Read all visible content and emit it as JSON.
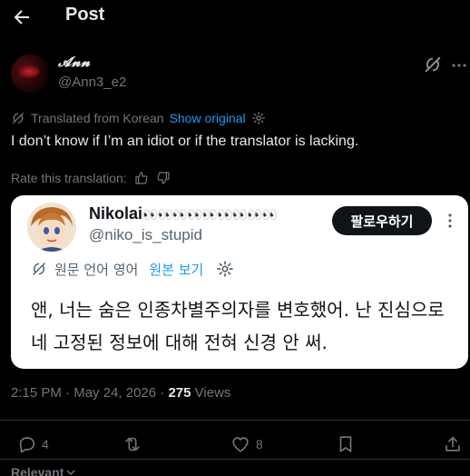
{
  "header": {
    "title": "Post"
  },
  "author": {
    "display_name": "𝓐𝓷𝓷",
    "handle": "@Ann3_e2"
  },
  "translation": {
    "label": "Translated from Korean",
    "show_original": "Show original",
    "rate_label": "Rate this translation:"
  },
  "tweet": {
    "text": "I don’t know if I’m an idiot or if the translator is lacking."
  },
  "embed": {
    "name": "Nikolai",
    "name_suffix": "👀👀👀👀👀👀👀👀👀",
    "handle": "@niko_is_stupid",
    "follow_label": "팔로우하기",
    "translation_label": "원문 언어 영어",
    "show_original": "원본 보기",
    "text": "앤, 너는 숨은 인종차별주의자를 변호했어. 난 진심으로 네 고정된 정보에 대해 전혀 신경 안 써."
  },
  "meta": {
    "time": "2:15 PM",
    "separator": " · ",
    "date": "May 24, 2026",
    "views_count": "275",
    "views_label": " Views"
  },
  "actions": {
    "replies": "4",
    "reposts": "",
    "likes": "8"
  },
  "replies_sort": {
    "label": "Relevant"
  },
  "colors": {
    "accent": "#1d9bf0",
    "background": "#000000",
    "muted": "#71767b",
    "text": "#e7e9ea",
    "divider": "#2f3336"
  }
}
